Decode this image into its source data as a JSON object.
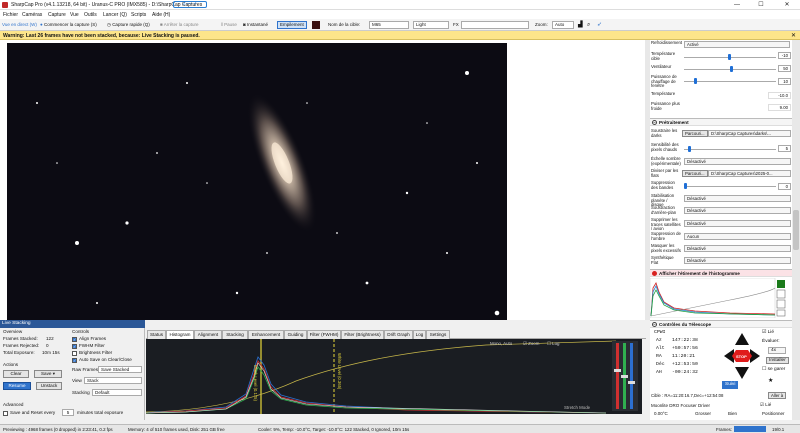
{
  "app": {
    "title": "SharpCap Pro (v4.1.13218, 64 bit) - Uranus-C PRO (IMX585) - D:\\SharpCap Captures",
    "quick_access": "2 — ✓",
    "minimize": "—",
    "maximize": "☐",
    "close": "✕"
  },
  "menu": [
    "Fichier",
    "Caméras",
    "Capture",
    "Vue",
    "Outils",
    "Lancer (Q)",
    "Scripts",
    "Aide (H)"
  ],
  "toolbar": {
    "view_button": "Vue en direct (W)",
    "start_capture": "Commencer la capture (S)",
    "quick_capture": "Capture rapide (Q)",
    "stop_capture": "Arrêter la capture",
    "pause": "Pause",
    "snapshot": "Instantané",
    "fitting": "Empilement",
    "target_label": "Nom de la cible:",
    "target_value": "M65",
    "light_value": "Light",
    "fx_label": "FX",
    "zoom_label": "Zoom:",
    "zoom_value": "Auto"
  },
  "warning": {
    "text": "Warning: Last 26 frames have not been stacked, because: Live Stacking is paused.",
    "close": "✕"
  },
  "right_panel": {
    "rows_top": [
      {
        "label": "Refroidissement",
        "value": "Activé",
        "type": "select"
      },
      {
        "label": "Température cible",
        "value": "-10",
        "type": "slider"
      },
      {
        "label": "Ventilateur",
        "value": "50",
        "type": "slider"
      },
      {
        "label": "Puissance de chauffage de fenêtre",
        "value": "10",
        "type": "slider"
      },
      {
        "label": "Température",
        "value": "-10.0",
        "type": "readonly"
      },
      {
        "label": "Puissance plus froide",
        "value": "9.00",
        "type": "readonly"
      }
    ],
    "preprocessing_title": "Prétraitement",
    "rows_pre": [
      {
        "label": "Soustraire les darks",
        "button": "Parcouri...",
        "value": "D:\\SharpCap Captures\\darks\\..."
      },
      {
        "label": "Sensibilité des pixels chauds",
        "value": "5",
        "type": "slider"
      },
      {
        "label": "Échelle sombre (expérimentale)",
        "value": "Désactivé",
        "type": "select"
      },
      {
        "label": "Diviser par les flats",
        "button": "Parcouri...",
        "value": "D:\\SharpCap Captures\\2025-0..."
      },
      {
        "label": "Suppression des bandes",
        "value": "0",
        "type": "slider"
      },
      {
        "label": "Stabilisation planète / disque",
        "value": "Désactivé",
        "type": "select"
      },
      {
        "label": "Soustraction d'arrière-plan",
        "value": "Désactivé",
        "type": "select"
      },
      {
        "label": "Supprimer les traces satellites / avion",
        "value": "Désactivé",
        "type": "select"
      },
      {
        "label": "Suppression de l'ombre",
        "value": "Aucun",
        "type": "select"
      },
      {
        "label": "Masquer les pixels excessifs",
        "value": "Désactivé",
        "type": "select"
      },
      {
        "label": "Synthétique Flat",
        "value": "Désactivé",
        "type": "select"
      }
    ],
    "histogram_title": "Afficher l'étirement de l'histogramme",
    "telescope_title": "Contrôles du Télescope",
    "telescope": {
      "cpwi": "CPWI",
      "linked_label": "Lié",
      "az_label": "Az",
      "az": "147:22:38",
      "alt_label": "Alt",
      "alt": "+50:57:56",
      "ra_label": "RA",
      "ra": "11:20:21",
      "dec_label": "Déc",
      "dec": "+12:53:50",
      "ah_label": "AH",
      "ah": "-00:24:32",
      "evaluer": "Évaluer:",
      "rate": "4x",
      "installer": "Installer",
      "se_garer": "se garer",
      "suivi": "Suivi",
      "stop": "STOP",
      "target_line": "Cible : RA=11:20:16.7,Dec=+12:54:08",
      "go_to": "Aller à"
    },
    "focuser": {
      "title": "Moonlite DRO Focuser Driver",
      "temp": "0.00°C",
      "grosser": "Grosser",
      "bien": "Bien",
      "position_label": "Positionner",
      "position": "15763",
      "linked": "Lié",
      "tcomp": "T. Comp",
      "negatif1": "Négatif",
      "negatif2": "Négatif",
      "step_label": "Taille de pas",
      "step": "10",
      "annuler": "Arrêter"
    }
  },
  "live_stacking": {
    "header": "Live Stacking",
    "overview": "Overview",
    "frames_stacked_label": "Frames Stacked:",
    "frames_stacked": "122",
    "frames_rejected_label": "Frames Rejected:",
    "frames_rejected": "0",
    "total_exposure_label": "Total Exposure:",
    "total_exposure": "10m 15s",
    "actions": "Actions",
    "clear": "Clear",
    "save": "Save",
    "resume": "Resume",
    "unstack": "Unstack",
    "advanced": "Advanced",
    "save_reset_label": "Save and Reset every",
    "save_reset_value": "5",
    "save_reset_unit": "minutes total exposure",
    "controls": "Controls",
    "align_frames": "Align Frames",
    "fwhm_filter": "FWHM Filter",
    "brightness_filter": "Brightness Filter",
    "auto_save": "Auto Save on Clear/Close",
    "raw_frames_label": "Raw Frames",
    "raw_frames": "Save Stacked",
    "view_label": "View",
    "view": "Stack",
    "stacking_label": "Stacking",
    "stacking": "Default"
  },
  "tabs": [
    "Status",
    "Histogram",
    "Alignment",
    "Stacking",
    "Enhancement",
    "Guiding",
    "Filter (FWHM)",
    "Filter (Brightness)",
    "Drift Graph",
    "Log",
    "Settings"
  ],
  "histogram": {
    "mono_auto": "Mono, Auto",
    "zoom": "Zoom",
    "log": "Log",
    "black_level": "Black Level (0.175)",
    "white_level": "White Level (0.365)",
    "stretch_mode": "Stretch Mode"
  },
  "status": {
    "previewing": "Previewing : 4968 frames (0 dropped) in 2:23:41, 0.2 fps",
    "memory": "Memory: 4 of 510 frames used, Disk: 251 GB free",
    "cooler": "Cooler: 9%, Temp: -10.0°C, Target: -10.0°C: 122 Stacked, 0 Ignored, 10m 15s",
    "frames_label": "Frames:",
    "frames_value": "19/0.1"
  },
  "colors": {
    "accent": "#2f73cc",
    "warning": "#fde58a",
    "sky": "#0c0b13",
    "histogram_bg": "#1a1d22"
  }
}
